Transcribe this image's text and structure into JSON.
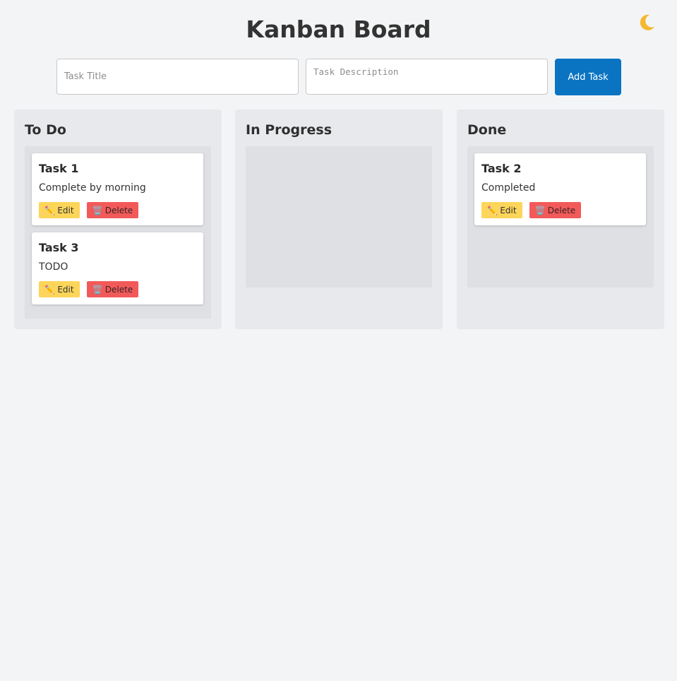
{
  "header": {
    "title": "Kanban Board",
    "theme_toggle_icon": "moon-icon"
  },
  "form": {
    "title_placeholder": "Task Title",
    "description_placeholder": "Task Description",
    "add_label": "Add Task"
  },
  "columns": [
    {
      "title": "To Do",
      "tasks": [
        {
          "title": "Task 1",
          "description": "Complete by morning",
          "edit_label": "Edit",
          "delete_label": "Delete",
          "edit_icon": "✏️",
          "delete_icon": "🗑️"
        },
        {
          "title": "Task 3",
          "description": "TODO",
          "edit_label": "Edit",
          "delete_label": "Delete",
          "edit_icon": "✏️",
          "delete_icon": "🗑️"
        }
      ]
    },
    {
      "title": "In Progress",
      "tasks": []
    },
    {
      "title": "Done",
      "tasks": [
        {
          "title": "Task 2",
          "description": "Completed",
          "edit_label": "Edit",
          "delete_label": "Delete",
          "edit_icon": "✏️",
          "delete_icon": "🗑️"
        }
      ]
    }
  ],
  "colors": {
    "background": "#f3f4f6",
    "accent": "#0a74c2",
    "edit": "#fcd55a",
    "delete": "#f25a5a",
    "moon": "#f5b82e"
  }
}
